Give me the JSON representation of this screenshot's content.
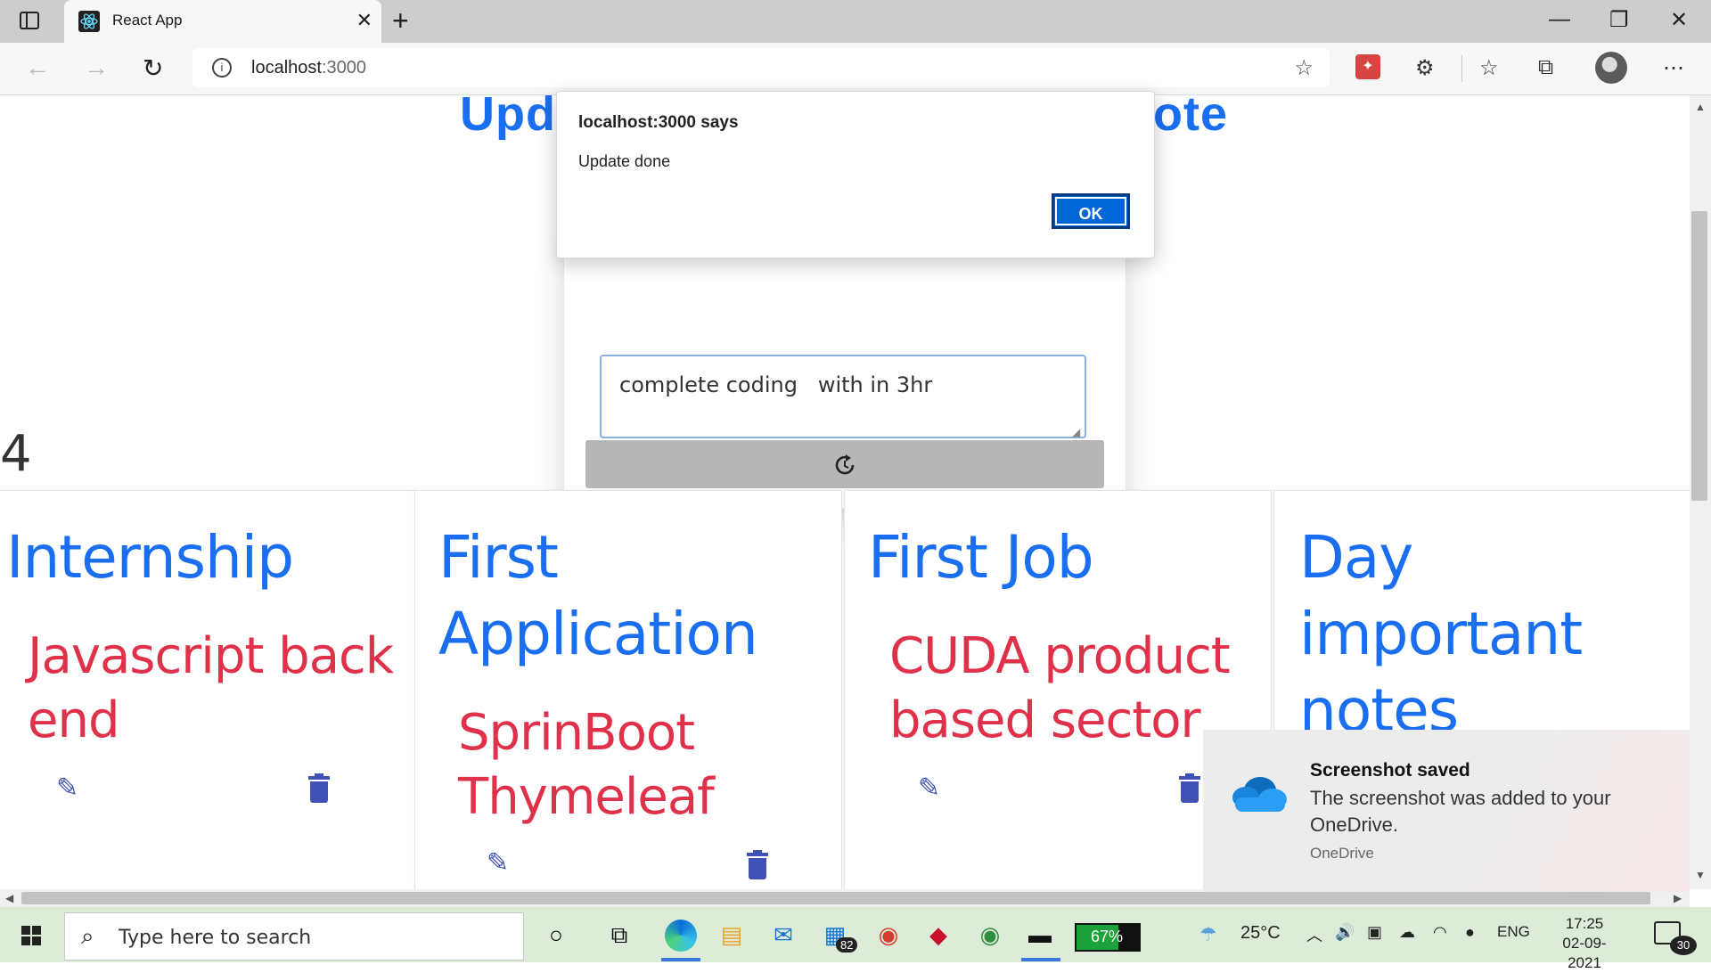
{
  "browser": {
    "tab_title": "React App",
    "url_host": "localhost",
    "url_port": ":3000"
  },
  "page": {
    "heading_left": "Upd",
    "heading_right": "ote",
    "textarea_value": "complete coding   with in 3hr",
    "notes_count": "4",
    "cards": [
      {
        "title": "Internship",
        "body": "Javascript back end"
      },
      {
        "title": "First Application",
        "body": "SprinBoot Thymeleaf"
      },
      {
        "title": "First Job",
        "body": "CUDA product based sector"
      },
      {
        "title": "Day important notes",
        "body": ""
      }
    ]
  },
  "dialog": {
    "title": "localhost:3000 says",
    "message": "Update done",
    "ok_label": "OK"
  },
  "toast": {
    "title": "Screenshot saved",
    "body": "The screenshot was added to your OneDrive.",
    "source": "OneDrive"
  },
  "taskbar": {
    "search_placeholder": "Type here to search",
    "store_badge": "82",
    "battery_percent": "67%",
    "battery_level": 0.67,
    "weather": "25°C",
    "language": "ENG",
    "time": "17:25",
    "date": "02-09-2021",
    "notification_count": "30"
  },
  "colors": {
    "heading": "#1a6ef0",
    "card_body": "#e0314a",
    "icon": "#3f51b5",
    "dialog_ok": "#0066d6"
  }
}
